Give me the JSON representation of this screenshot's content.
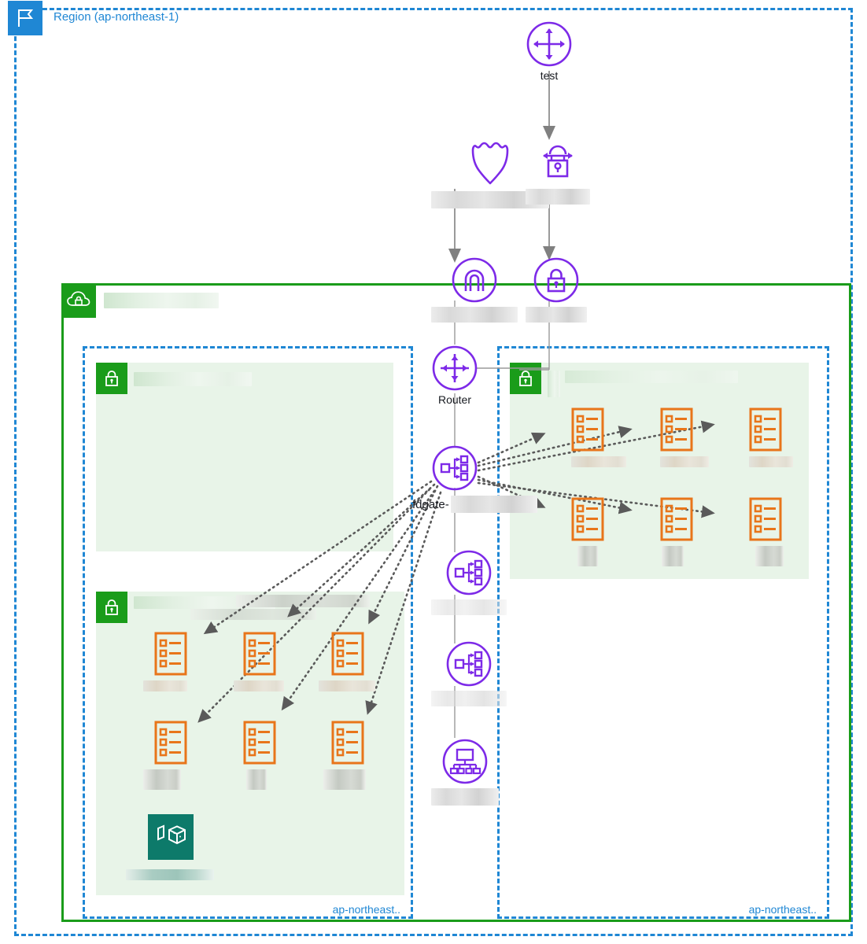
{
  "region": {
    "label": "Region (ap-northeast-1)",
    "icon": "region-flag-icon",
    "border_color": "#1f87d4"
  },
  "vpc": {
    "icon": "vpc-cloud-lock-icon",
    "label": "",
    "label_redacted": true,
    "border_color": "#1a9c1a"
  },
  "availability_zones": [
    {
      "id": "az-left",
      "label": "ap-northeast.."
    },
    {
      "id": "az-right",
      "label": "ap-northeast.."
    }
  ],
  "external_nodes": [
    {
      "id": "transit-gateway-test",
      "icon": "transit-gateway-icon",
      "label": "test",
      "redacted": false
    },
    {
      "id": "route53",
      "icon": "route53-shield-icon",
      "label": "",
      "redacted": true
    },
    {
      "id": "site-to-site-vpn",
      "icon": "vpn-lock-arrows-icon",
      "label": "",
      "redacted": true
    }
  ],
  "gateway_nodes": [
    {
      "id": "internet-gateway",
      "icon": "internet-gateway-icon",
      "label": "",
      "redacted": true
    },
    {
      "id": "vpn-gateway",
      "icon": "vpn-gateway-lock-icon",
      "label": "",
      "redacted": true
    }
  ],
  "spine_nodes": [
    {
      "id": "router",
      "icon": "router-icon",
      "label": "Router",
      "redacted": false
    },
    {
      "id": "load-balancer-1",
      "icon": "load-balancer-icon",
      "label": "fdgate-",
      "redacted": true
    },
    {
      "id": "load-balancer-2",
      "icon": "load-balancer-icon",
      "label": "",
      "redacted": true
    },
    {
      "id": "load-balancer-3",
      "icon": "load-balancer-icon",
      "label": "",
      "redacted": true
    },
    {
      "id": "ecs-cluster",
      "icon": "ecs-cluster-icon",
      "label": "",
      "redacted": true
    }
  ],
  "security_groups": [
    {
      "id": "sg-left-top",
      "icon": "security-group-lock-icon",
      "label": "",
      "redacted": true,
      "tasks": 0
    },
    {
      "id": "sg-left-bottom",
      "icon": "security-group-lock-icon",
      "label": "",
      "redacted": true,
      "tasks": 6
    },
    {
      "id": "sg-right-top",
      "icon": "security-group-lock-icon",
      "label": "",
      "redacted": true,
      "tasks": 6
    }
  ],
  "tasks": {
    "icon": "ecs-task-icon",
    "color": "#e8751a",
    "label_redacted": true
  },
  "registry": {
    "id": "ecr-registry",
    "icon": "ecr-container-registry-icon",
    "color": "#0d7a6a",
    "label": "",
    "label_redacted": true
  },
  "colors": {
    "region_blue": "#1f87d4",
    "vpc_green": "#1a9c1a",
    "node_purple": "#7d2ae8",
    "task_orange": "#e8751a",
    "registry_teal": "#0d7a6a",
    "sg_fill": "#e8f4e8",
    "arrow_gray": "#5a5a5a"
  }
}
